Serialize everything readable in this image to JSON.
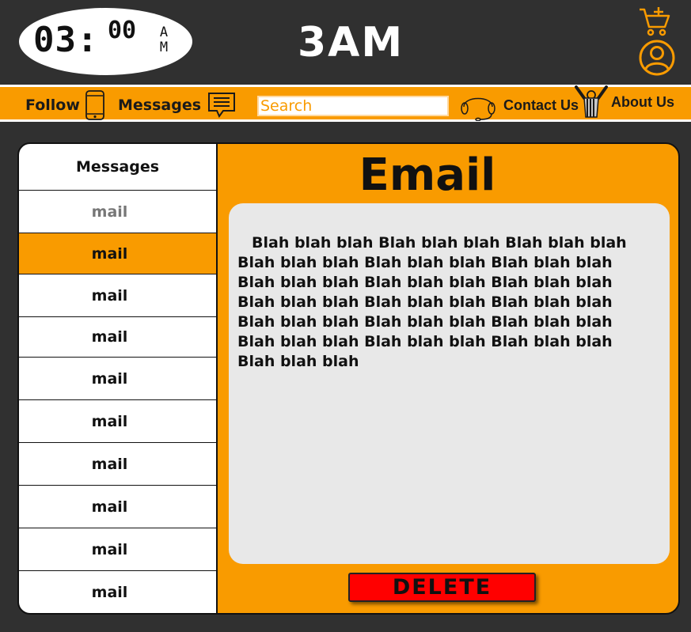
{
  "header": {
    "clock_hours": "03:",
    "clock_minutes": "00",
    "clock_ampm": "AM",
    "brand": "3AM"
  },
  "nav": {
    "follow_label": "Follow",
    "messages_label": "Messages",
    "search_placeholder": "Search",
    "contact_label": "Contact Us",
    "about_label": "About Us"
  },
  "sidebar": {
    "header": "Messages",
    "items": [
      {
        "label": "mail",
        "state": "dim"
      },
      {
        "label": "mail",
        "state": "selected"
      },
      {
        "label": "mail",
        "state": "normal"
      },
      {
        "label": "mail",
        "state": "normal"
      },
      {
        "label": "mail",
        "state": "normal"
      },
      {
        "label": "mail",
        "state": "normal"
      },
      {
        "label": "mail",
        "state": "normal"
      },
      {
        "label": "mail",
        "state": "normal"
      },
      {
        "label": "mail",
        "state": "normal"
      },
      {
        "label": "mail",
        "state": "normal"
      }
    ]
  },
  "email": {
    "title": "Email",
    "body": "Blah blah blah Blah blah blah Blah blah blah Blah blah blah Blah blah blah Blah blah blah Blah blah blah Blah blah blah Blah blah blah Blah blah blah Blah blah blah Blah blah blah Blah blah blah Blah blah blah Blah blah blah Blah blah blah Blah blah blah Blah blah blah Blah blah blah",
    "delete_label": "DELETE"
  },
  "colors": {
    "accent": "#f99b00",
    "background": "#303030",
    "delete": "#ff0000"
  },
  "icons": [
    "cart-plus-icon",
    "user-circle-icon",
    "phone-icon",
    "message-icon",
    "headset-icon",
    "referee-icon"
  ]
}
